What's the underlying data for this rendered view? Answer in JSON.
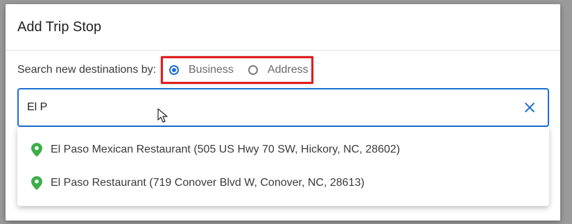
{
  "dialog": {
    "title": "Add Trip Stop"
  },
  "search": {
    "label": "Search new destinations by:",
    "options": [
      {
        "label": "Business",
        "selected": true
      },
      {
        "label": "Address",
        "selected": false
      }
    ],
    "input_value": "El P",
    "accent_color": "#1a6fd1",
    "highlight_color": "#e21b1b"
  },
  "results": [
    {
      "label": "El Paso Mexican Restaurant (505 US Hwy 70 SW, Hickory, NC, 28602)",
      "icon": "map-pin-icon"
    },
    {
      "label": "El Paso Restaurant (719 Conover Blvd W, Conover, NC, 28613)",
      "icon": "map-pin-icon"
    }
  ],
  "icons": {
    "clear": "close-icon",
    "pointer": "mouse-pointer-icon",
    "pin_color": "#3fae49"
  }
}
